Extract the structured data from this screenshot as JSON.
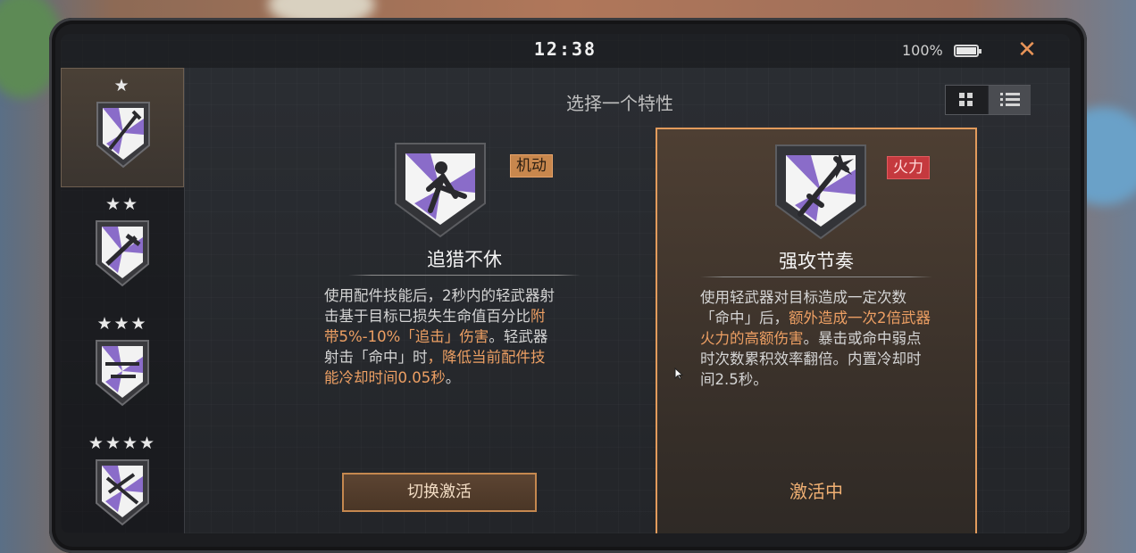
{
  "status": {
    "time": "12:38",
    "battery": "100%"
  },
  "header": {
    "title": "选择一个特性"
  },
  "sidebar": {
    "tiers": [
      {
        "stars": "★",
        "active": true,
        "icon": "perk-emblem-icon"
      },
      {
        "stars": "★★",
        "active": false,
        "icon": "perk-emblem-icon"
      },
      {
        "stars": "★★★",
        "active": false,
        "icon": "perk-emblem-icon"
      },
      {
        "stars": "★★★★",
        "active": false,
        "icon": "perk-emblem-icon"
      }
    ]
  },
  "cards": [
    {
      "tag": "机动",
      "name": "追猎不休",
      "desc": [
        {
          "text": "使用配件技能后，2秒内的轻武器射击基于目标已损失生命值百分比",
          "hl": false
        },
        {
          "text": "附带5%-10%「追击」伤害",
          "hl": true
        },
        {
          "text": "。轻武器射击「命中」时",
          "hl": false
        },
        {
          "text": "，降低当前配件技能冷却时间0.05秒",
          "hl": true
        },
        {
          "text": "。",
          "hl": false
        }
      ],
      "button": "切换激活"
    },
    {
      "tag": "火力",
      "name": "强攻节奏",
      "desc": [
        {
          "text": "使用轻武器对目标造成一定次数「命中」后，",
          "hl": false
        },
        {
          "text": "额外造成一次2倍武器火力的高额伤害",
          "hl": true
        },
        {
          "text": "。暴击或命中弱点时次数累积效率翻倍。内置冷却时间2.5秒。",
          "hl": false
        }
      ],
      "status": "激活中"
    }
  ],
  "colors": {
    "accent": "#e29b5c",
    "mobility": "#c8874d",
    "firepower": "#c5393e",
    "emblem_purple": "#8a6cc9"
  }
}
